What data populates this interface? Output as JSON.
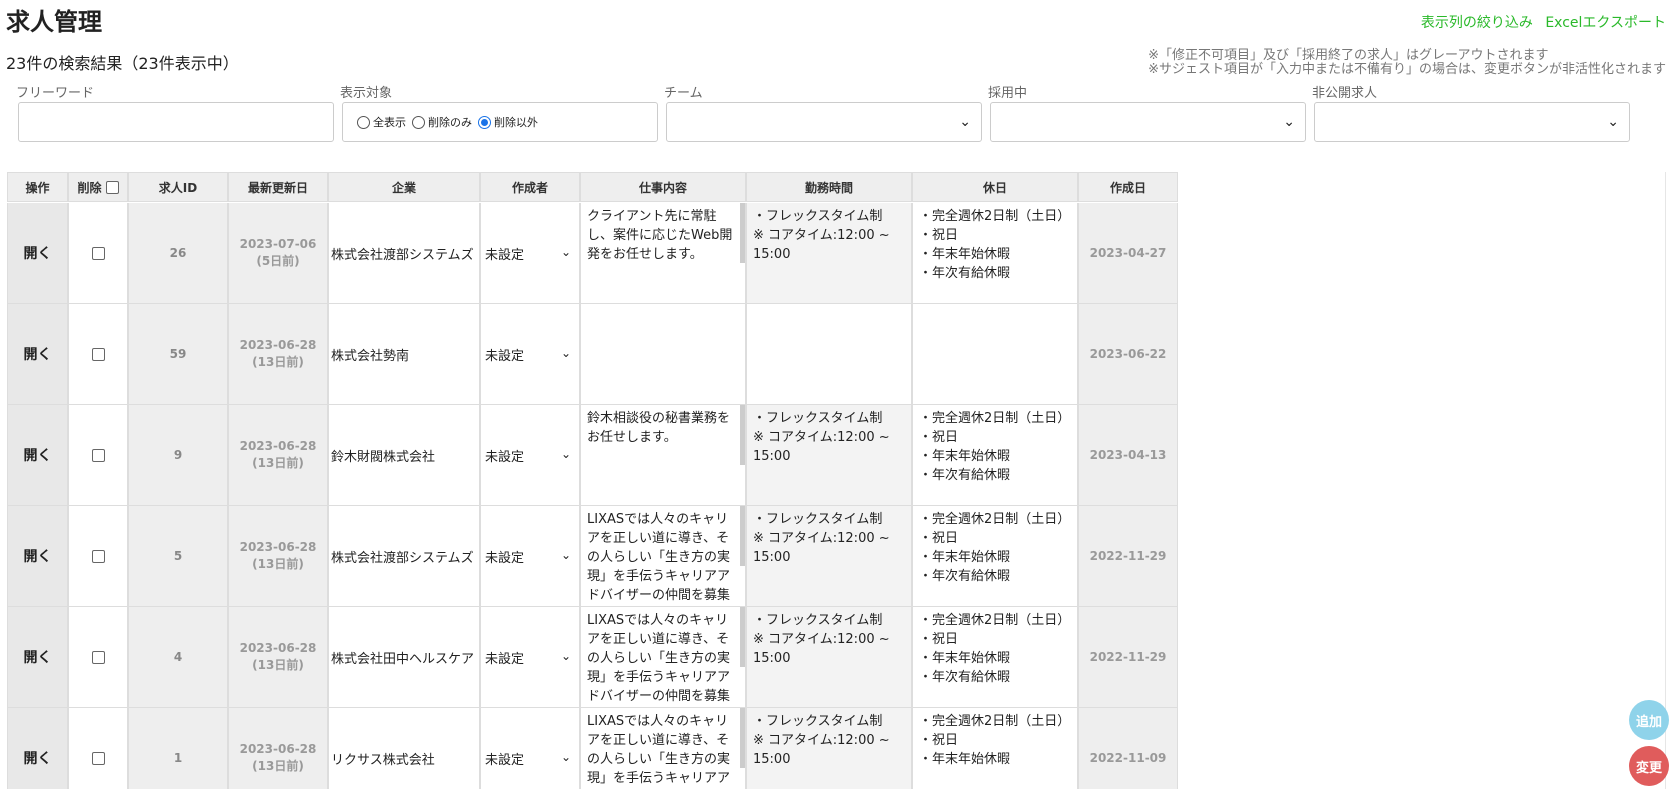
{
  "page": {
    "title": "求人管理",
    "result_count": "23件の検索結果（23件表示中）"
  },
  "top_links": {
    "column_filter": "表示列の絞り込み",
    "excel_export": "Excelエクスポート"
  },
  "notes": {
    "line1": "※「修正不可項目」及び「採用終了の求人」はグレーアウトされます",
    "line2": "※サジェスト項目が「入力中または不備有り」の場合は、変更ボタンが非活性化されます"
  },
  "filters": {
    "freeword": {
      "label": "フリーワード",
      "value": ""
    },
    "display": {
      "label": "表示対象",
      "options": [
        "全表示",
        "削除のみ",
        "削除以外"
      ],
      "selected": "削除以外"
    },
    "team": {
      "label": "チーム",
      "value": ""
    },
    "hiring": {
      "label": "採用中",
      "value": ""
    },
    "private": {
      "label": "非公開求人",
      "value": ""
    }
  },
  "table": {
    "headers": {
      "operation": "操作",
      "delete": "削除",
      "job_id": "求人ID",
      "updated": "最新更新日",
      "company": "企業",
      "creator": "作成者",
      "job_content": "仕事内容",
      "work_hours": "勤務時間",
      "holidays": "休日",
      "created": "作成日"
    },
    "open_label": "開く",
    "rows": [
      {
        "id": "26",
        "updated": "2023-07-06",
        "updated_ago": "(5日前)",
        "company": "株式会社渡部システムズ",
        "creator": "未設定",
        "content": "クライアント先に常駐し、案件に応じたWeb開発をお任せします。",
        "hours": "・フレックスタイム制\n※ コアタイム:12:00 ~ 15:00",
        "holidays": "・完全週休2日制（土日）\n・祝日\n・年末年始休暇\n・年次有給休暇",
        "created": "2023-04-27"
      },
      {
        "id": "59",
        "updated": "2023-06-28",
        "updated_ago": "(13日前)",
        "company": "株式会社勢南",
        "creator": "未設定",
        "content": "",
        "hours": "",
        "holidays": "",
        "created": "2023-06-22"
      },
      {
        "id": "9",
        "updated": "2023-06-28",
        "updated_ago": "(13日前)",
        "company": "鈴木財閥株式会社",
        "creator": "未設定",
        "content": "鈴木相談役の秘書業務をお任せします。",
        "hours": "・フレックスタイム制\n※ コアタイム:12:00 ~ 15:00",
        "holidays": "・完全週休2日制（土日）\n・祝日\n・年末年始休暇\n・年次有給休暇",
        "created": "2023-04-13"
      },
      {
        "id": "5",
        "updated": "2023-06-28",
        "updated_ago": "(13日前)",
        "company": "株式会社渡部システムズ",
        "creator": "未設定",
        "content": "LIXASでは人々のキャリアを正しい道に導き、その人らしい「生き方の実現」を手伝うキャリアアドバイザーの仲間を募集",
        "hours": "・フレックスタイム制\n※ コアタイム:12:00 ~ 15:00",
        "holidays": "・完全週休2日制（土日）\n・祝日\n・年末年始休暇\n・年次有給休暇",
        "created": "2022-11-29"
      },
      {
        "id": "4",
        "updated": "2023-06-28",
        "updated_ago": "(13日前)",
        "company": "株式会社田中ヘルスケア",
        "creator": "未設定",
        "content": "LIXASでは人々のキャリアを正しい道に導き、その人らしい「生き方の実現」を手伝うキャリアアドバイザーの仲間を募集",
        "hours": "・フレックスタイム制\n※ コアタイム:12:00 ~ 15:00",
        "holidays": "・完全週休2日制（土日）\n・祝日\n・年末年始休暇\n・年次有給休暇",
        "created": "2022-11-29"
      },
      {
        "id": "1",
        "updated": "2023-06-28",
        "updated_ago": "(13日前)",
        "company": "リクサス株式会社",
        "creator": "未設定",
        "content": "LIXASでは人々のキャリアを正しい道に導き、その人らしい「生き方の実現」を手伝うキャリアア",
        "hours": "・フレックスタイム制\n※ コアタイム:12:00 ~ 15:00",
        "holidays": "・完全週休2日制（土日）\n・祝日\n・年末年始休暇",
        "created": "2022-11-09"
      }
    ]
  },
  "fab": {
    "add": "追加",
    "change": "変更"
  }
}
